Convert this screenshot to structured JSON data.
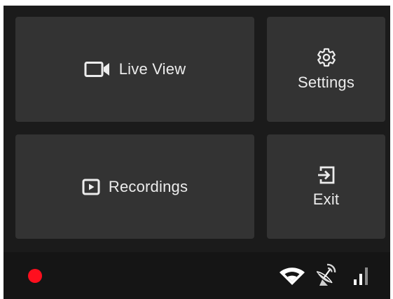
{
  "tiles": {
    "live_view": {
      "label": "Live View",
      "icon": "video-camera-icon"
    },
    "settings": {
      "label": "Settings",
      "icon": "gear-icon"
    },
    "recordings": {
      "label": "Recordings",
      "icon": "play-box-icon"
    },
    "exit": {
      "label": "Exit",
      "icon": "exit-icon"
    }
  },
  "status_bar": {
    "recording_indicator": "recording-dot",
    "icons": [
      "wifi-icon",
      "satellite-dish-icon",
      "signal-bars-icon"
    ]
  },
  "colors": {
    "background": "#1b1b1b",
    "tile": "#333333",
    "status_bar": "#151515",
    "text": "#ececec",
    "recording": "#ff0f1e"
  }
}
